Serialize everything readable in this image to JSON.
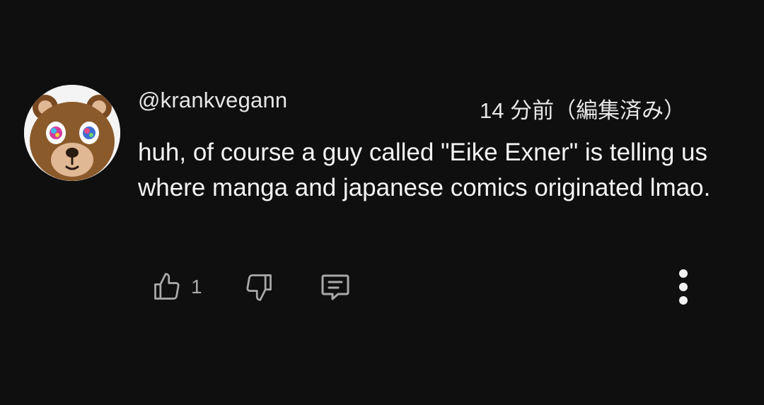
{
  "comment": {
    "author": "@krankvegann",
    "timestamp": "14 分前（編集済み）",
    "text": "huh, of course a guy called \"Eike Exner\" is telling us where manga and japanese comics originated lmao.",
    "like_count": "1"
  },
  "icons": {
    "avatar": "bear-avatar",
    "like": "thumbs-up-icon",
    "dislike": "thumbs-down-icon",
    "reply": "comment-reply-icon",
    "more": "more-vertical-icon"
  },
  "colors": {
    "background": "#0f0f0f",
    "text": "#f1f1f1",
    "icon": "#aaaaaa",
    "avatar_fur": "#8b5a2b"
  }
}
